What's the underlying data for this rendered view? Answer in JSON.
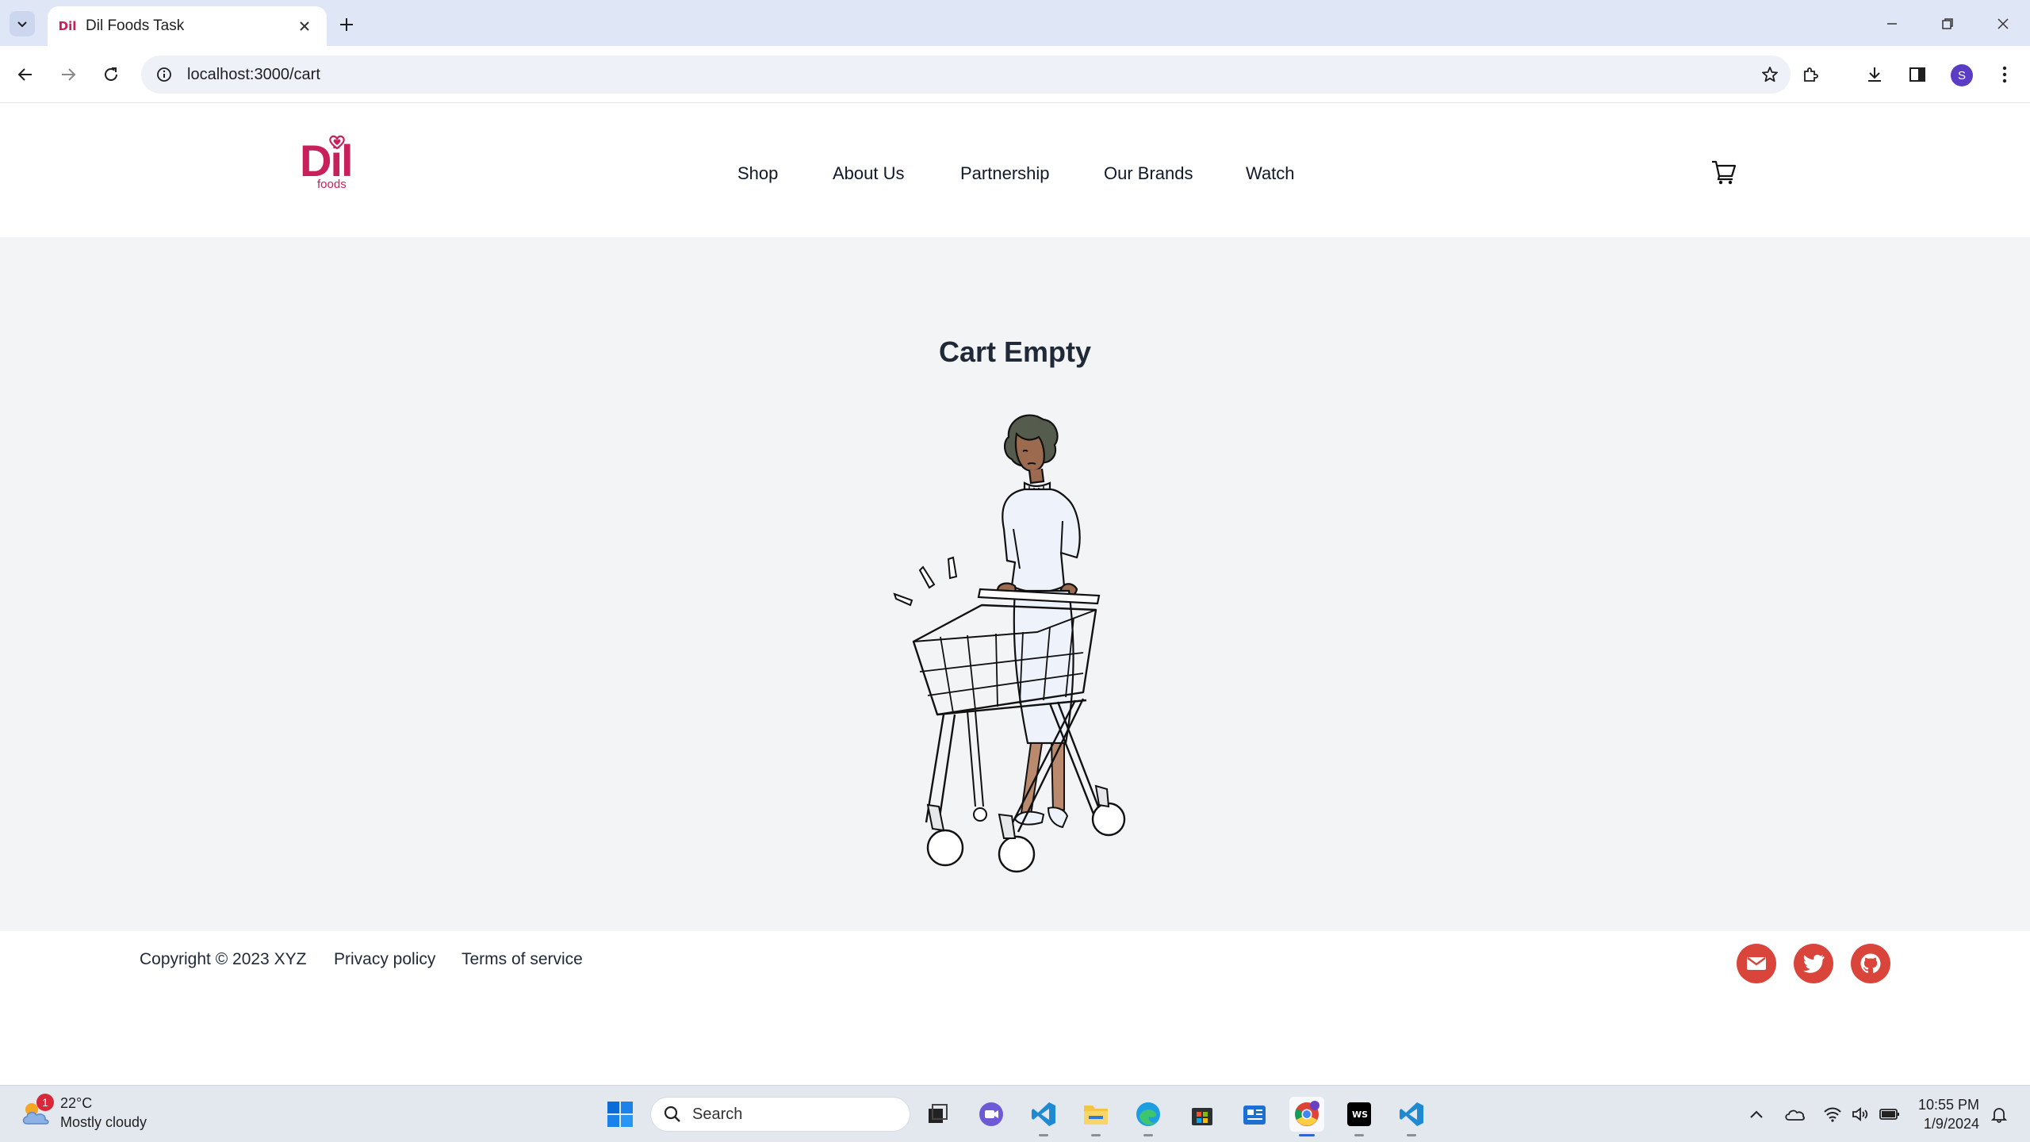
{
  "browser": {
    "tab_title": "Dil Foods Task",
    "favicon_text": "Dil",
    "url": "localhost:3000/cart",
    "profile_initial": "S"
  },
  "site": {
    "logo_text": "Dil",
    "logo_subtext": "foods",
    "brand_color": "#c8205a",
    "nav": [
      "Shop",
      "About Us",
      "Partnership",
      "Our Brands",
      "Watch"
    ],
    "cart_icon": "cart-icon"
  },
  "main": {
    "title": "Cart Empty",
    "illustration": "woman-with-empty-shopping-cart"
  },
  "footer": {
    "copyright": "Copyright © 2023 XYZ",
    "privacy": "Privacy policy",
    "terms": "Terms of service",
    "social_icons": [
      "mail-icon",
      "twitter-icon",
      "github-icon"
    ],
    "social_color": "#d9453b"
  },
  "taskbar": {
    "weather_temp": "22°C",
    "weather_desc": "Mostly cloudy",
    "weather_badge": "1",
    "search_placeholder": "Search",
    "time": "10:55 PM",
    "date": "1/9/2024",
    "apps": [
      "windows-start-icon",
      "search-icon",
      "task-view-icon",
      "meet-icon",
      "vscode-icon",
      "file-explorer-icon",
      "edge-icon",
      "store-icon",
      "news-icon",
      "chrome-icon",
      "webstorm-icon",
      "vscode-icon"
    ]
  }
}
